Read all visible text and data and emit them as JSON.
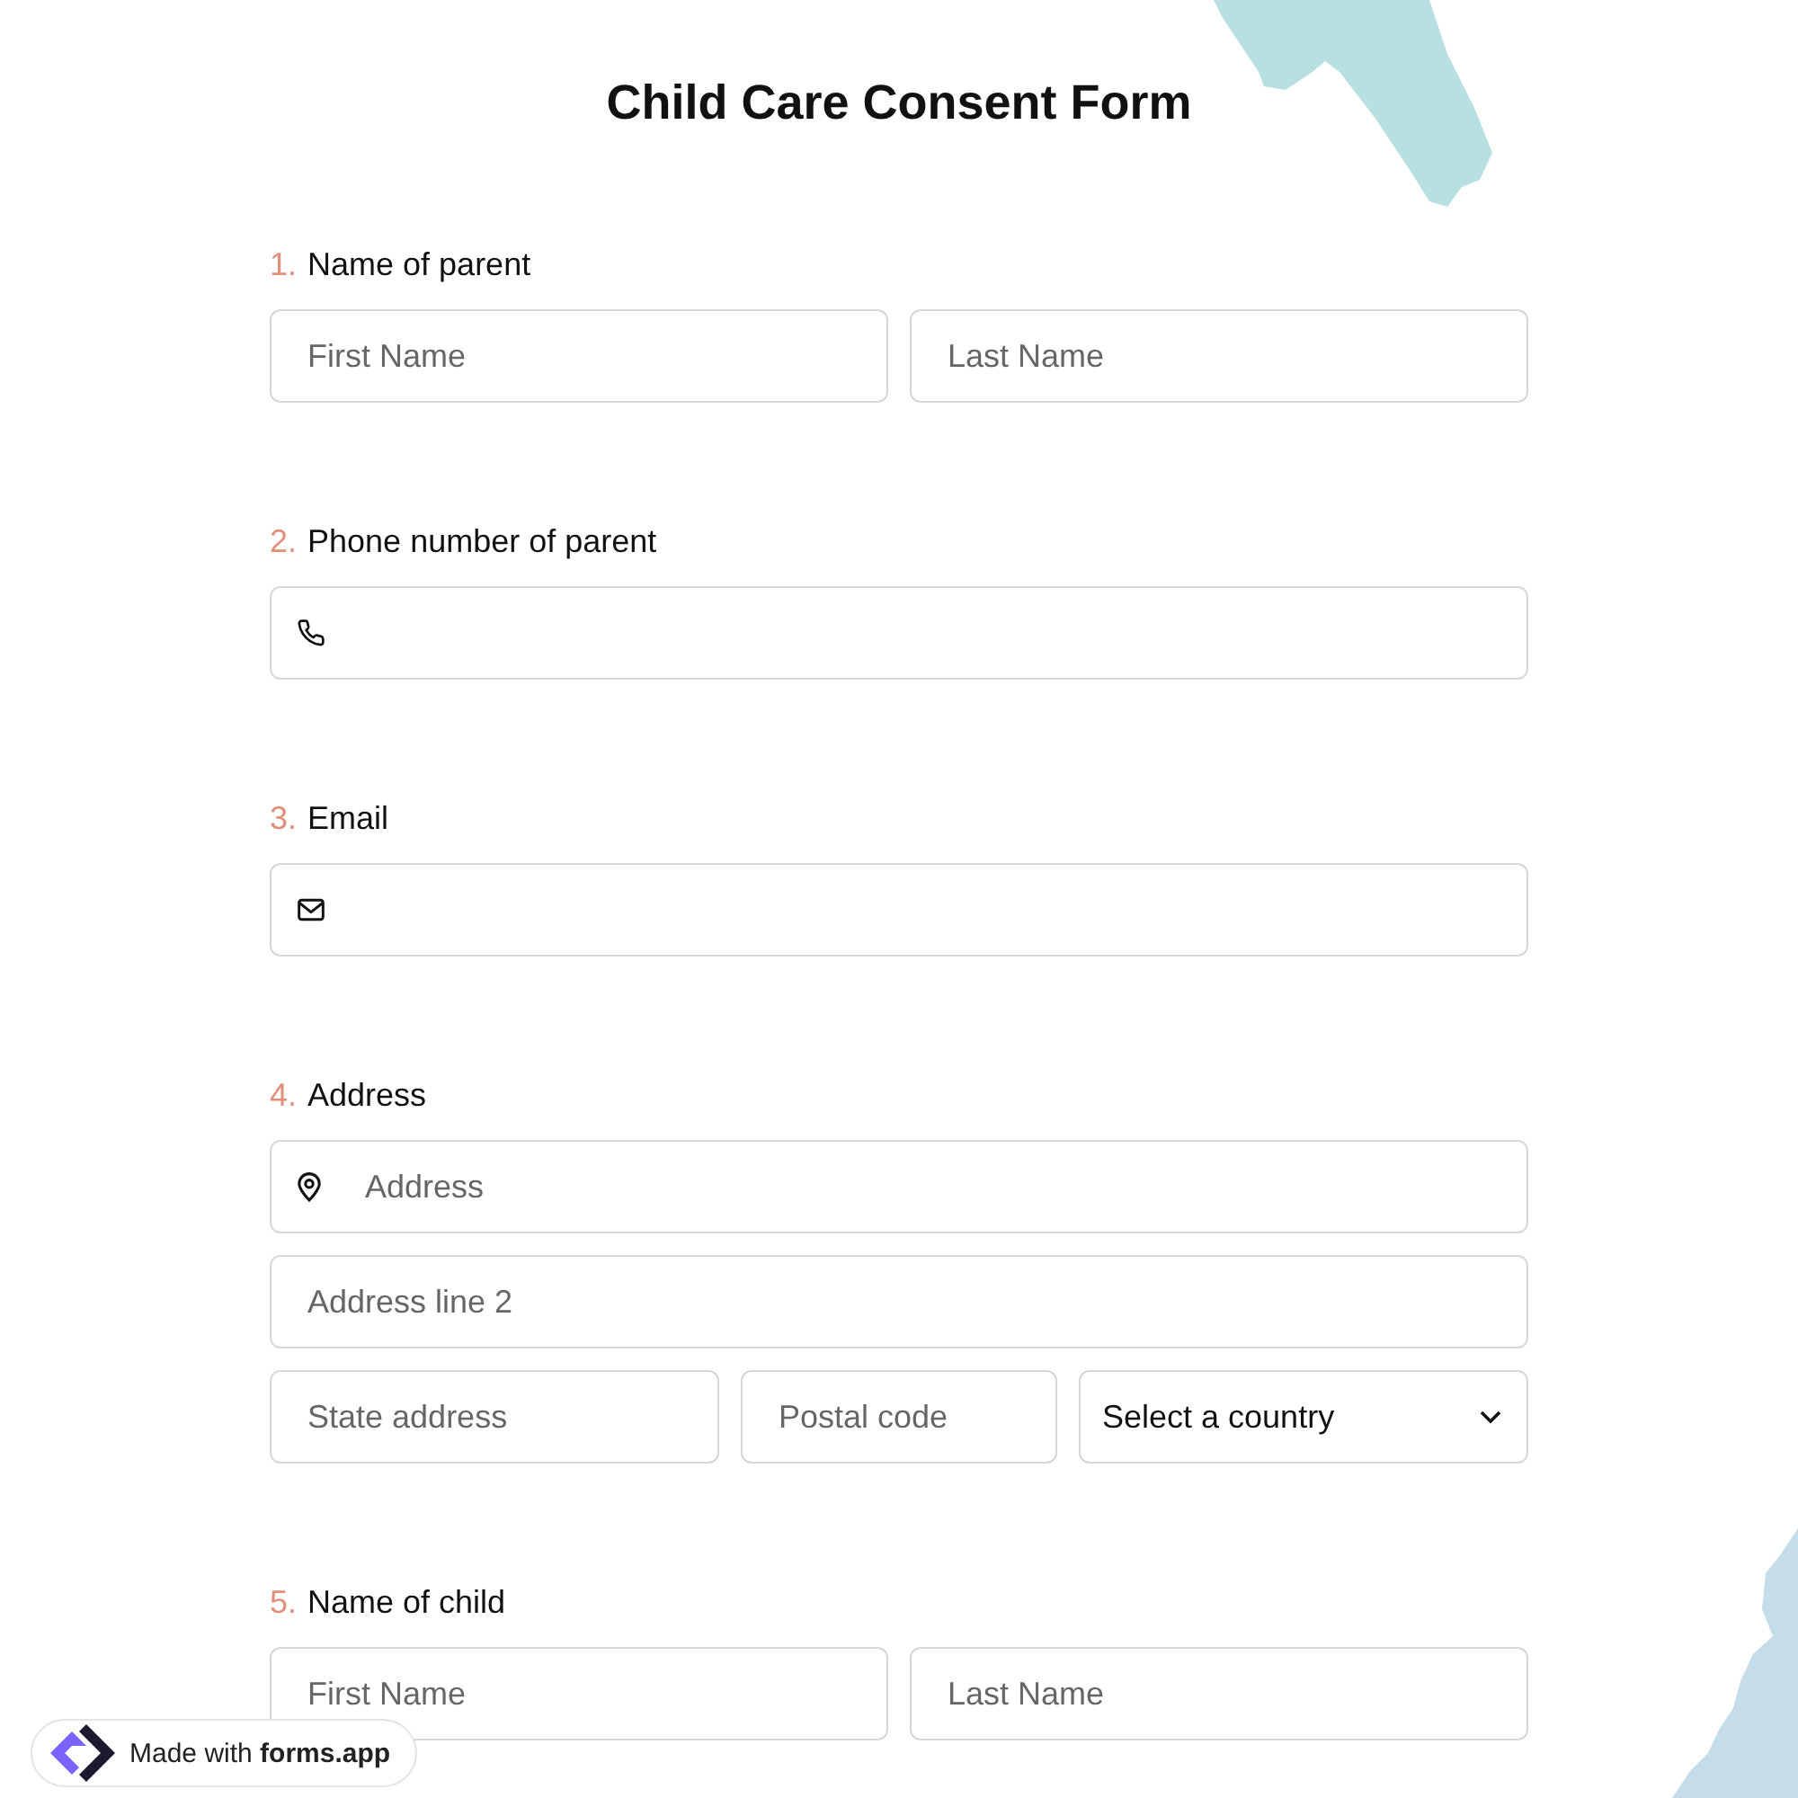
{
  "title": "Child Care Consent Form",
  "questions": [
    {
      "number": "1.",
      "label": "Name of parent",
      "kind": "name",
      "fields": [
        {
          "placeholder": "First Name"
        },
        {
          "placeholder": "Last Name"
        }
      ]
    },
    {
      "number": "2.",
      "label": "Phone number of parent",
      "kind": "phone"
    },
    {
      "number": "3.",
      "label": "Email",
      "kind": "email"
    },
    {
      "number": "4.",
      "label": "Address",
      "kind": "address",
      "fields": [
        {
          "placeholder": "Address"
        },
        {
          "placeholder": "Address line 2"
        },
        {
          "placeholder": "State address"
        },
        {
          "placeholder": "Postal code"
        },
        {
          "label": "Select a country"
        }
      ]
    },
    {
      "number": "5.",
      "label": "Name of child",
      "kind": "name",
      "fields": [
        {
          "placeholder": "First Name"
        },
        {
          "placeholder": "Last Name"
        }
      ]
    }
  ],
  "badge": {
    "prefix": "Made with",
    "brand": "forms.app"
  }
}
